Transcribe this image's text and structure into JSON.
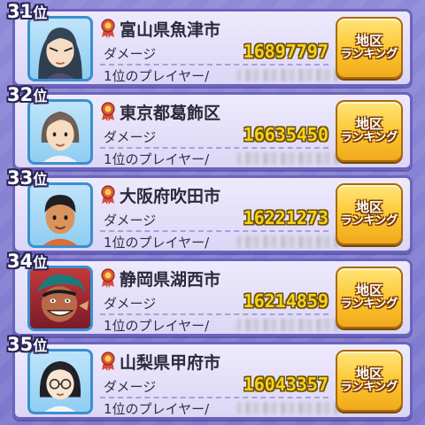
{
  "entries": [
    {
      "rank": "31",
      "rank_suffix": "位",
      "region": "富山県魚津市",
      "damage_label": "ダメージ",
      "damage": "16897797",
      "top_player_label": "1位のプレイヤー/",
      "button_line1": "地区",
      "button_line2": "ランキング",
      "avatar": "girl-dark-hair-icon"
    },
    {
      "rank": "32",
      "rank_suffix": "位",
      "region": "東京都葛飾区",
      "damage_label": "ダメージ",
      "damage": "16635450",
      "top_player_label": "1位のプレイヤー/",
      "button_line1": "地区",
      "button_line2": "ランキング",
      "avatar": "adult-woman-icon"
    },
    {
      "rank": "33",
      "rank_suffix": "位",
      "region": "大阪府吹田市",
      "damage_label": "ダメージ",
      "damage": "16221273",
      "top_player_label": "1位のプレイヤー/",
      "button_line1": "地区",
      "button_line2": "ランキング",
      "avatar": "boy-tan-icon"
    },
    {
      "rank": "34",
      "rank_suffix": "位",
      "region": "静岡県湖西市",
      "damage_label": "ダメージ",
      "damage": "16214859",
      "top_player_label": "1位のプレイヤー/",
      "button_line1": "地区",
      "button_line2": "ランキング",
      "avatar": "grinning-man-icon"
    },
    {
      "rank": "35",
      "rank_suffix": "位",
      "region": "山梨県甲府市",
      "damage_label": "ダメージ",
      "damage": "16043357",
      "top_player_label": "1位のプレイヤー/",
      "button_line1": "地区",
      "button_line2": "ランキング",
      "avatar": "girl-glasses-icon"
    }
  ],
  "colors": {
    "damage": "#f5d21c",
    "button": "#fcc52e",
    "panel": "#e6e2fa",
    "border": "#6b63c0"
  }
}
